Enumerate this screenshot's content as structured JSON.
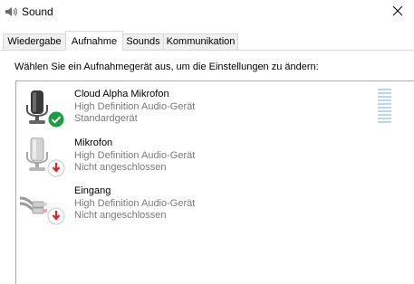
{
  "window": {
    "title": "Sound"
  },
  "tabs": [
    {
      "label": "Wiedergabe",
      "active": false
    },
    {
      "label": "Aufnahme",
      "active": true
    },
    {
      "label": "Sounds",
      "active": false
    },
    {
      "label": "Kommunikation",
      "active": false
    }
  ],
  "instruction": "Wählen Sie ein Aufnahmegerät aus, um die Einstellungen zu ändern:",
  "devices": [
    {
      "name": "Cloud Alpha Mikrofon",
      "driver": "High Definition Audio-Gerät",
      "status": "Standardgerät",
      "icon": "microphone-icon",
      "badge": "default-checkmark-icon"
    },
    {
      "name": "Mikrofon",
      "driver": "High Definition Audio-Gerät",
      "status": "Nicht angeschlossen",
      "icon": "microphone-icon",
      "badge": "disconnected-arrow-icon"
    },
    {
      "name": "Eingang",
      "driver": "High Definition Audio-Gerät",
      "status": "Nicht angeschlossen",
      "icon": "line-in-cable-icon",
      "badge": "disconnected-arrow-icon"
    }
  ],
  "colors": {
    "default_badge": "#1a9e3f",
    "disconnected_badge": "#d9262b",
    "selection_hint": "#b5d8eb"
  }
}
